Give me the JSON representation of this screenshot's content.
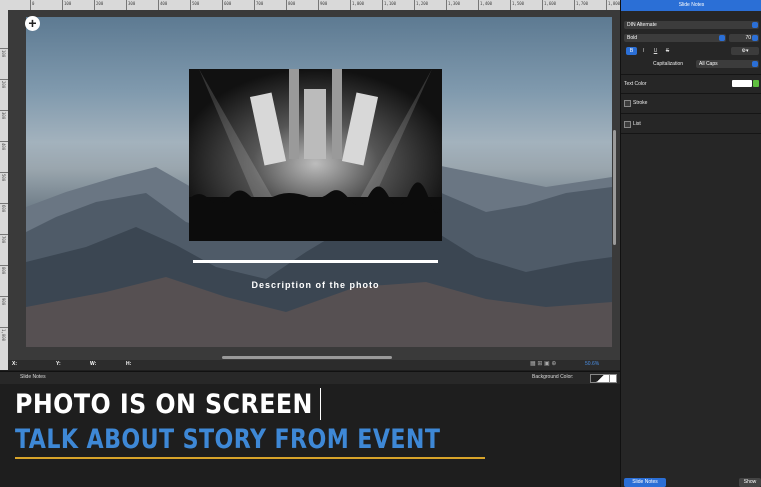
{
  "ruler": {
    "top_labels": [
      "0",
      "100",
      "200",
      "300",
      "400",
      "500",
      "600",
      "700",
      "800",
      "900",
      "1,000",
      "1,100",
      "1,200",
      "1,300",
      "1,400",
      "1,500",
      "1,600",
      "1,700",
      "1,800"
    ],
    "left_labels": [
      "100",
      "200",
      "300",
      "400",
      "500",
      "600",
      "700",
      "800",
      "900",
      "1,000"
    ]
  },
  "slide": {
    "caption": "Description of the photo"
  },
  "coords": {
    "x_label": "X:",
    "y_label": "Y:",
    "w_label": "W:",
    "h_label": "H:"
  },
  "zoom": {
    "value": "50.6%"
  },
  "notes_bar": {
    "title": "Slide Notes",
    "background_color_label": "Background Color:"
  },
  "notes": {
    "line1": "PHOTO IS ON SCREEN",
    "line2": "TALK ABOUT STORY FROM EVENT",
    "line2_color": "#3e88d6",
    "underline_color": "#d8a42a"
  },
  "inspector": {
    "tab_label": "Slide Notes",
    "font_family": "DIN Alternate",
    "font_weight": "Bold",
    "font_size": "70",
    "format_buttons": [
      "B",
      "I",
      "U",
      "S"
    ],
    "capitalization_label": "Capitalization",
    "capitalization_value": "All Caps",
    "text_color_label": "Text Color",
    "stroke_label": "Stroke",
    "list_label": "List",
    "accent_color": "#2b6fd6"
  },
  "bottom_tabs": {
    "slide_notes": "Slide Notes",
    "show": "Show"
  }
}
